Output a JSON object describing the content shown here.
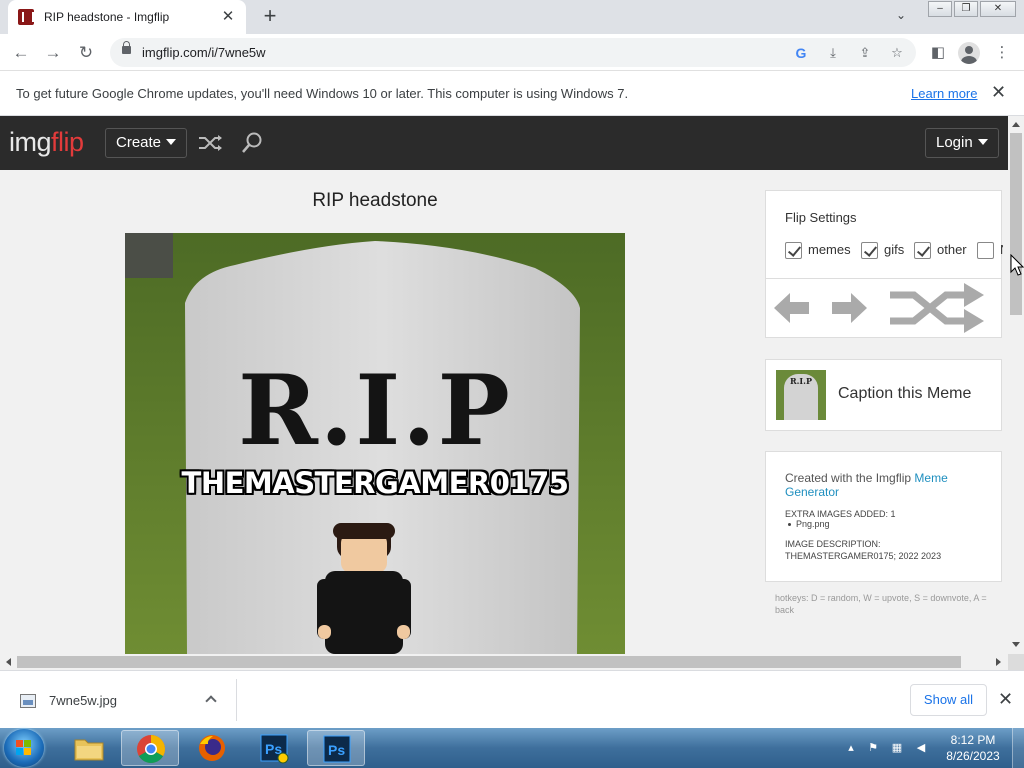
{
  "browser": {
    "tab_title": "RIP headstone - Imgflip",
    "url": "imgflip.com/i/7wne5w",
    "window_controls": [
      "–",
      "❐",
      "✕"
    ]
  },
  "infobar": {
    "message": "To get future Google Chrome updates, you'll need Windows 10 or later. This computer is using Windows 7.",
    "link": "Learn more"
  },
  "site": {
    "logo_part1": "img",
    "logo_part2": "flip",
    "create_label": "Create",
    "login_label": "Login"
  },
  "meme": {
    "title": "RIP headstone",
    "headstone_text": "R.I.P",
    "caption": "THEMASTERGAMER0175"
  },
  "flip_settings": {
    "title": "Flip Settings",
    "options": [
      {
        "label": "memes",
        "checked": true
      },
      {
        "label": "gifs",
        "checked": true
      },
      {
        "label": "other",
        "checked": true
      },
      {
        "label": "N",
        "checked": false
      }
    ]
  },
  "caption_panel": {
    "thumb_text": "R.I.P",
    "label": "Caption this Meme"
  },
  "info_panel": {
    "created_prefix": "Created with the Imgflip ",
    "created_link": "Meme Generator",
    "extra_label": "EXTRA IMAGES ADDED: 1",
    "extra_item": "Png.png",
    "desc_label": "IMAGE DESCRIPTION:",
    "desc_value": "THEMASTERGAMER0175; 2022 2023"
  },
  "hotkeys": "hotkeys: D = random, W = upvote, S = downvote, A = back",
  "downloads": {
    "file_name": "7wne5w.jpg",
    "show_all": "Show all"
  },
  "taskbar": {
    "time": "8:12 PM",
    "date": "8/26/2023",
    "apps": [
      "windows-explorer",
      "google-chrome",
      "firefox",
      "photoshop-installer",
      "photoshop"
    ]
  },
  "colors": {
    "imgflip_header": "#2b2b2b",
    "imgflip_red": "#e23b3b",
    "chrome_link": "#1a73e8",
    "taskbar": "#3e6f9c"
  }
}
